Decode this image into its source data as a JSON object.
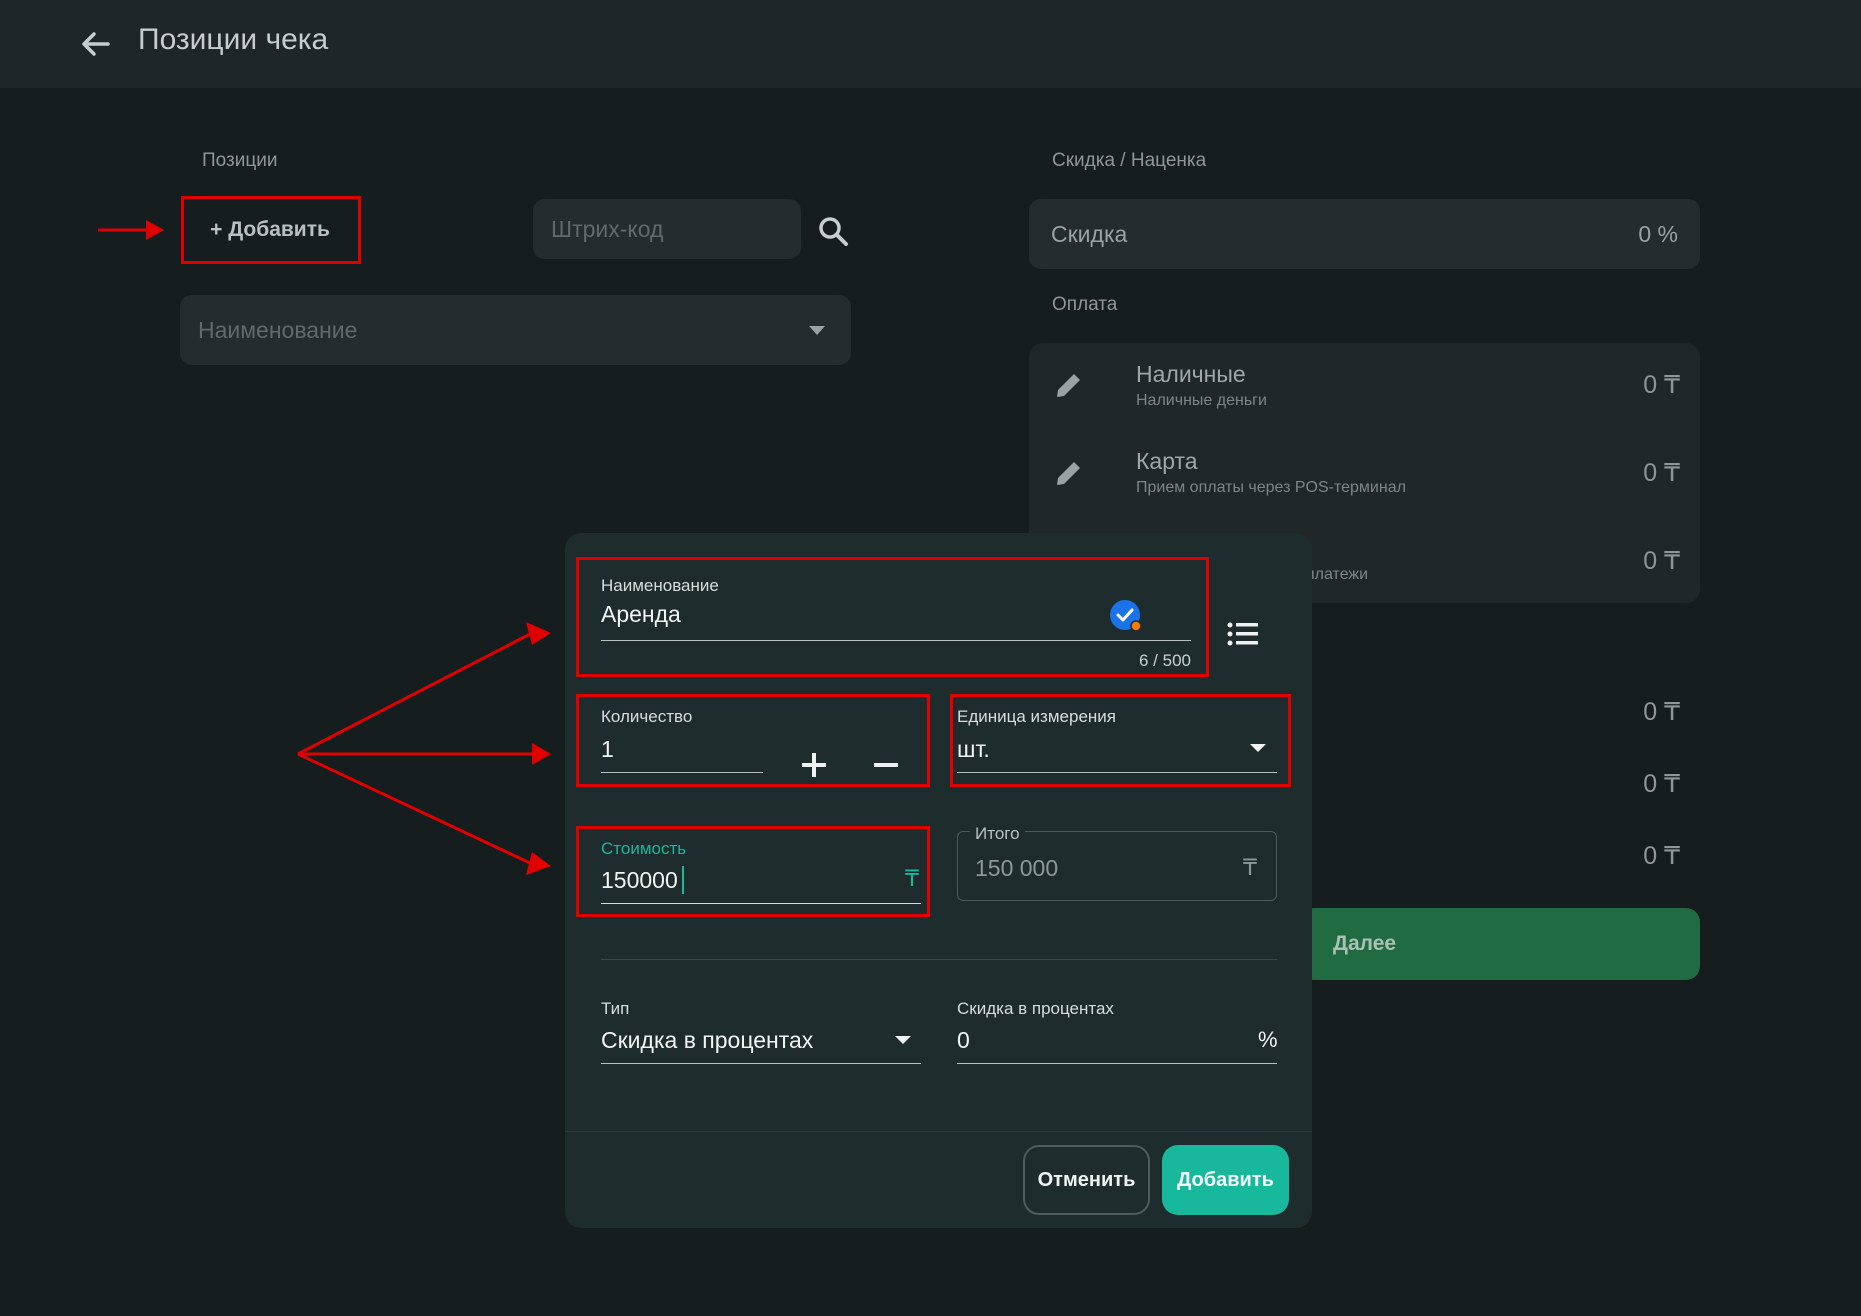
{
  "header": {
    "title": "Позиции чека",
    "back_icon": "arrow-left-icon"
  },
  "left": {
    "section_label": "Позиции",
    "add_button": "+ Добавить",
    "barcode_placeholder": "Штрих-код",
    "name_placeholder": "Наименование"
  },
  "right": {
    "discount_section": "Скидка / Наценка",
    "discount_label": "Скидка",
    "discount_value": "0 %",
    "payment_section": "Оплата",
    "payments": [
      {
        "title": "Наличные",
        "subtitle": "Наличные деньги",
        "amount": "0 ₸"
      },
      {
        "title": "Карта",
        "subtitle": "Прием оплаты через POS-терминал",
        "amount": "0 ₸"
      },
      {
        "title": "",
        "subtitle": "платежи",
        "amount": "0 ₸"
      }
    ],
    "totals": [
      "0 ₸",
      "0 ₸",
      "0 ₸"
    ],
    "next_button": "Далее"
  },
  "dialog": {
    "name_label": "Наименование",
    "name_value": "Аренда",
    "name_counter": "6 / 500",
    "qty_label": "Количество",
    "qty_value": "1",
    "unit_label": "Единица измерения",
    "unit_value": "шт.",
    "cost_label": "Стоимость",
    "cost_value": "150000",
    "cost_suffix": "₸",
    "total_label": "Итого",
    "total_value": "150 000",
    "total_suffix": "₸",
    "type_label": "Тип",
    "type_value": "Скидка в процентах",
    "percent_label": "Скидка в процентах",
    "percent_value": "0",
    "percent_suffix": "%",
    "cancel_button": "Отменить",
    "add_button": "Добавить"
  },
  "colors": {
    "accent": "#18b89c",
    "annotation_red": "#e10000",
    "next_green": "#216b43",
    "verified_blue": "#1a73e8"
  }
}
